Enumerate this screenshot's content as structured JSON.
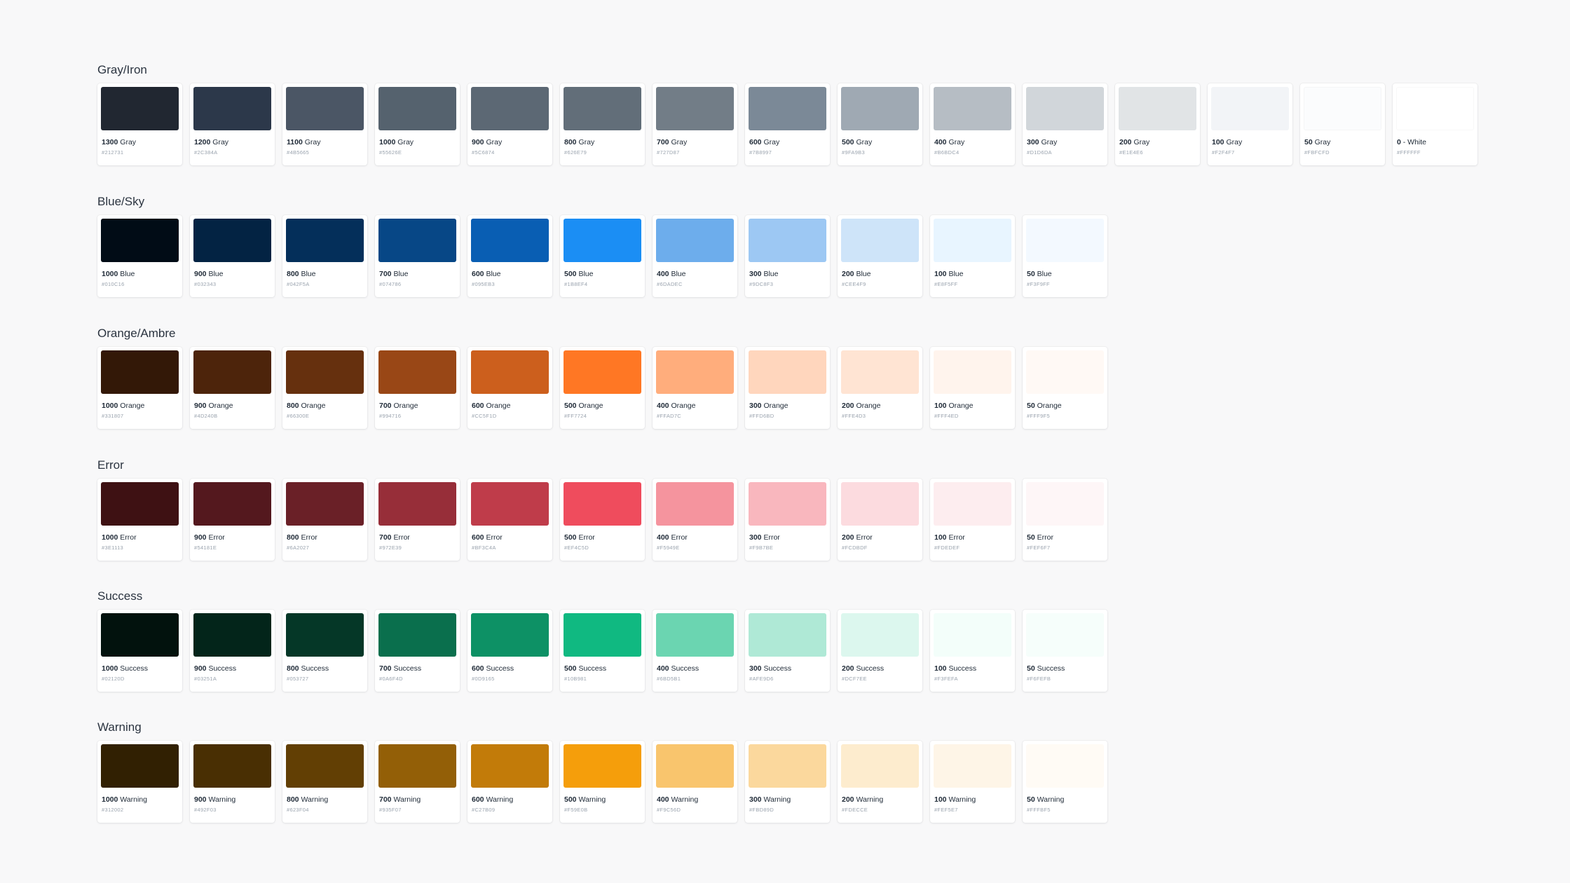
{
  "groups": [
    {
      "title": "Gray/Iron",
      "swatches": [
        {
          "shade": "1300",
          "name": "Gray",
          "hex": "#212731"
        },
        {
          "shade": "1200",
          "name": "Gray",
          "hex": "#2C384A"
        },
        {
          "shade": "1100",
          "name": "Gray",
          "hex": "#4B5665"
        },
        {
          "shade": "1000",
          "name": "Gray",
          "hex": "#55626E"
        },
        {
          "shade": "900",
          "name": "Gray",
          "hex": "#5C6874"
        },
        {
          "shade": "800",
          "name": "Gray",
          "hex": "#626E79"
        },
        {
          "shade": "700",
          "name": "Gray",
          "hex": "#727D87"
        },
        {
          "shade": "600",
          "name": "Gray",
          "hex": "#7B8997"
        },
        {
          "shade": "500",
          "name": "Gray",
          "hex": "#9FA9B3"
        },
        {
          "shade": "400",
          "name": "Gray",
          "hex": "#B6BDC4"
        },
        {
          "shade": "300",
          "name": "Gray",
          "hex": "#D1D6DA"
        },
        {
          "shade": "200",
          "name": "Gray",
          "hex": "#E1E4E6"
        },
        {
          "shade": "100",
          "name": "Gray",
          "hex": "#F2F4F7"
        },
        {
          "shade": "50",
          "name": "Gray",
          "hex": "#FBFCFD"
        },
        {
          "shade": "0",
          "name": "- White",
          "hex": "#FFFFFF"
        }
      ]
    },
    {
      "title": "Blue/Sky",
      "swatches": [
        {
          "shade": "1000",
          "name": "Blue",
          "hex": "#010C16"
        },
        {
          "shade": "900",
          "name": "Blue",
          "hex": "#032343"
        },
        {
          "shade": "800",
          "name": "Blue",
          "hex": "#042F5A"
        },
        {
          "shade": "700",
          "name": "Blue",
          "hex": "#074786"
        },
        {
          "shade": "600",
          "name": "Blue",
          "hex": "#095EB3"
        },
        {
          "shade": "500",
          "name": "Blue",
          "hex": "#1B8EF4"
        },
        {
          "shade": "400",
          "name": "Blue",
          "hex": "#6DADEC"
        },
        {
          "shade": "300",
          "name": "Blue",
          "hex": "#9DC8F3"
        },
        {
          "shade": "200",
          "name": "Blue",
          "hex": "#CEE4F9"
        },
        {
          "shade": "100",
          "name": "Blue",
          "hex": "#E8F5FF"
        },
        {
          "shade": "50",
          "name": "Blue",
          "hex": "#F3F9FF"
        }
      ]
    },
    {
      "title": "Orange/Ambre",
      "swatches": [
        {
          "shade": "1000",
          "name": "Orange",
          "hex": "#331807"
        },
        {
          "shade": "900",
          "name": "Orange",
          "hex": "#4D240B"
        },
        {
          "shade": "800",
          "name": "Orange",
          "hex": "#66300E"
        },
        {
          "shade": "700",
          "name": "Orange",
          "hex": "#994716"
        },
        {
          "shade": "600",
          "name": "Orange",
          "hex": "#CC5F1D"
        },
        {
          "shade": "500",
          "name": "Orange",
          "hex": "#FF7724"
        },
        {
          "shade": "400",
          "name": "Orange",
          "hex": "#FFAD7C"
        },
        {
          "shade": "300",
          "name": "Orange",
          "hex": "#FFD6BD"
        },
        {
          "shade": "200",
          "name": "Orange",
          "hex": "#FFE4D3"
        },
        {
          "shade": "100",
          "name": "Orange",
          "hex": "#FFF4ED"
        },
        {
          "shade": "50",
          "name": "Orange",
          "hex": "#FFF9F5"
        }
      ]
    },
    {
      "title": "Error",
      "swatches": [
        {
          "shade": "1000",
          "name": "Error",
          "hex": "#3E1113"
        },
        {
          "shade": "900",
          "name": "Error",
          "hex": "#54181E"
        },
        {
          "shade": "800",
          "name": "Error",
          "hex": "#6A2027"
        },
        {
          "shade": "700",
          "name": "Error",
          "hex": "#972E39"
        },
        {
          "shade": "600",
          "name": "Error",
          "hex": "#BF3C4A"
        },
        {
          "shade": "500",
          "name": "Error",
          "hex": "#EF4C5D"
        },
        {
          "shade": "400",
          "name": "Error",
          "hex": "#F5949E"
        },
        {
          "shade": "300",
          "name": "Error",
          "hex": "#F9B7BE"
        },
        {
          "shade": "200",
          "name": "Error",
          "hex": "#FCDBDF"
        },
        {
          "shade": "100",
          "name": "Error",
          "hex": "#FDEDEF"
        },
        {
          "shade": "50",
          "name": "Error",
          "hex": "#FEF6F7"
        }
      ]
    },
    {
      "title": "Success",
      "swatches": [
        {
          "shade": "1000",
          "name": "Success",
          "hex": "#02120D"
        },
        {
          "shade": "900",
          "name": "Success",
          "hex": "#03251A"
        },
        {
          "shade": "800",
          "name": "Success",
          "hex": "#053727"
        },
        {
          "shade": "700",
          "name": "Success",
          "hex": "#0A6F4D"
        },
        {
          "shade": "600",
          "name": "Success",
          "hex": "#0D9165"
        },
        {
          "shade": "500",
          "name": "Success",
          "hex": "#10B981"
        },
        {
          "shade": "400",
          "name": "Success",
          "hex": "#6BD5B1"
        },
        {
          "shade": "300",
          "name": "Success",
          "hex": "#AFE9D6"
        },
        {
          "shade": "200",
          "name": "Success",
          "hex": "#DCF7EE"
        },
        {
          "shade": "100",
          "name": "Success",
          "hex": "#F3FEFA"
        },
        {
          "shade": "50",
          "name": "Success",
          "hex": "#F6FEFB"
        }
      ]
    },
    {
      "title": "Warning",
      "swatches": [
        {
          "shade": "1000",
          "name": "Warning",
          "hex": "#312002"
        },
        {
          "shade": "900",
          "name": "Warning",
          "hex": "#492F03"
        },
        {
          "shade": "800",
          "name": "Warning",
          "hex": "#623F04"
        },
        {
          "shade": "700",
          "name": "Warning",
          "hex": "#935F07"
        },
        {
          "shade": "600",
          "name": "Warning",
          "hex": "#C27B09"
        },
        {
          "shade": "500",
          "name": "Warning",
          "hex": "#F59E0B"
        },
        {
          "shade": "400",
          "name": "Warning",
          "hex": "#F9C56D"
        },
        {
          "shade": "300",
          "name": "Warning",
          "hex": "#FBD89D"
        },
        {
          "shade": "200",
          "name": "Warning",
          "hex": "#FDECCE"
        },
        {
          "shade": "100",
          "name": "Warning",
          "hex": "#FEF5E7"
        },
        {
          "shade": "50",
          "name": "Warning",
          "hex": "#FFFBF5"
        }
      ]
    }
  ]
}
